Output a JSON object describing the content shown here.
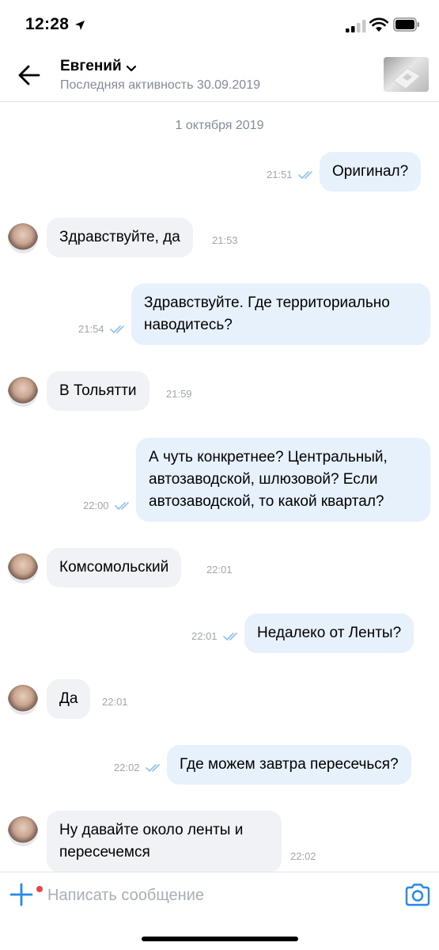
{
  "status_bar": {
    "time": "12:28"
  },
  "header": {
    "contact_name": "Евгений",
    "last_seen": "Последняя активность 30.09.2019"
  },
  "feed": {
    "date_separator": "1 октября 2019",
    "messages": [
      {
        "direction": "out",
        "text": "Оригинал?",
        "time": "21:51",
        "read": true
      },
      {
        "direction": "in",
        "text": "Здравствуйте, да",
        "time": "21:53"
      },
      {
        "direction": "out",
        "text": "Здравствуйте. Где территориально наводитесь?",
        "time": "21:54",
        "read": true
      },
      {
        "direction": "in",
        "text": "В Тольятти",
        "time": "21:59"
      },
      {
        "direction": "out",
        "text": "А чуть конкретнее? Центральный, автозаводской, шлюзовой? Если автозаводской, то какой квартал?",
        "time": "22:00",
        "read": true
      },
      {
        "direction": "in",
        "text": "Комсомольский",
        "time": "22:01"
      },
      {
        "direction": "out",
        "text": "Недалеко от Ленты?",
        "time": "22:01",
        "read": true
      },
      {
        "direction": "in",
        "text": "Да",
        "time": "22:01"
      },
      {
        "direction": "out",
        "text": "Где можем завтра пересечься?",
        "time": "22:02",
        "read": true
      },
      {
        "direction": "in",
        "text": "Ну давайте около ленты и пересечемся",
        "time": "22:02"
      }
    ]
  },
  "composer": {
    "placeholder": "Написать сообщение"
  },
  "colors": {
    "accent": "#2688eb",
    "outgoing_bubble": "#e6f1fb",
    "incoming_bubble": "#f0f2f5",
    "read_ticks": "#8fc2f0",
    "notification_dot": "#e64646"
  }
}
